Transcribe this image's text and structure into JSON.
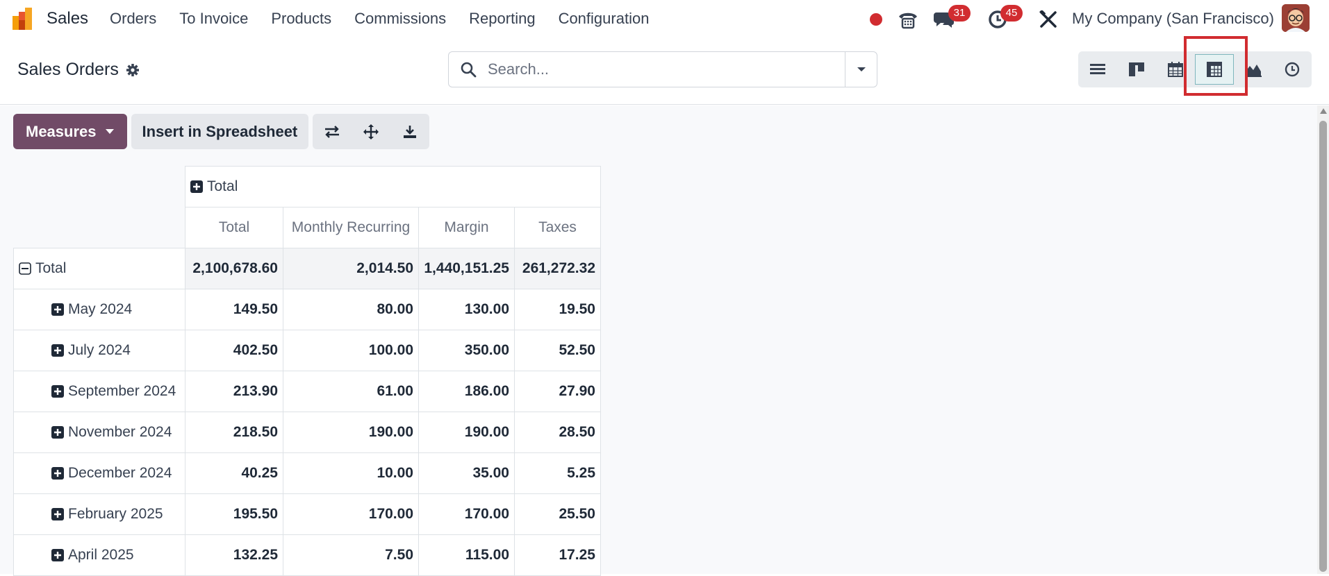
{
  "navbar": {
    "app_name": "Sales",
    "menu": [
      "Orders",
      "To Invoice",
      "Products",
      "Commissions",
      "Reporting",
      "Configuration"
    ],
    "messages_count": "31",
    "activities_count": "45",
    "company": "My Company (San Francisco)",
    "icons": [
      "record-dot-icon",
      "phone-icon",
      "chat-icon",
      "clock-icon",
      "tools-icon"
    ]
  },
  "control_panel": {
    "breadcrumb": "Sales Orders",
    "search_placeholder": "Search...",
    "views": [
      "list-view-icon",
      "kanban-view-icon",
      "calendar-view-icon",
      "pivot-view-icon",
      "graph-view-icon",
      "activity-view-icon"
    ],
    "active_view": "pivot-view-icon"
  },
  "toolbar": {
    "measures_label": "Measures",
    "insert_label": "Insert in Spreadsheet",
    "icons": [
      "flip-axis-icon",
      "expand-all-icon",
      "download-icon"
    ]
  },
  "pivot": {
    "col_group_label": "Total",
    "columns": [
      "Total",
      "Monthly Recurring",
      "Margin",
      "Taxes"
    ],
    "total_row": {
      "label": "Total",
      "values": [
        "2,100,678.60",
        "2,014.50",
        "1,440,151.25",
        "261,272.32"
      ]
    },
    "rows": [
      {
        "label": "May 2024",
        "values": [
          "149.50",
          "80.00",
          "130.00",
          "19.50"
        ]
      },
      {
        "label": "July 2024",
        "values": [
          "402.50",
          "100.00",
          "350.00",
          "52.50"
        ]
      },
      {
        "label": "September 2024",
        "values": [
          "213.90",
          "61.00",
          "186.00",
          "27.90"
        ]
      },
      {
        "label": "November 2024",
        "values": [
          "218.50",
          "190.00",
          "190.00",
          "28.50"
        ]
      },
      {
        "label": "December 2024",
        "values": [
          "40.25",
          "10.00",
          "35.00",
          "5.25"
        ]
      },
      {
        "label": "February 2025",
        "values": [
          "195.50",
          "170.00",
          "170.00",
          "25.50"
        ]
      },
      {
        "label": "April 2025",
        "values": [
          "132.25",
          "7.50",
          "115.00",
          "17.25"
        ]
      }
    ]
  },
  "colors": {
    "primary": "#714b67",
    "badge": "#d12c30",
    "highlight": "#d12c30",
    "active_view": "#e6f2f3"
  }
}
